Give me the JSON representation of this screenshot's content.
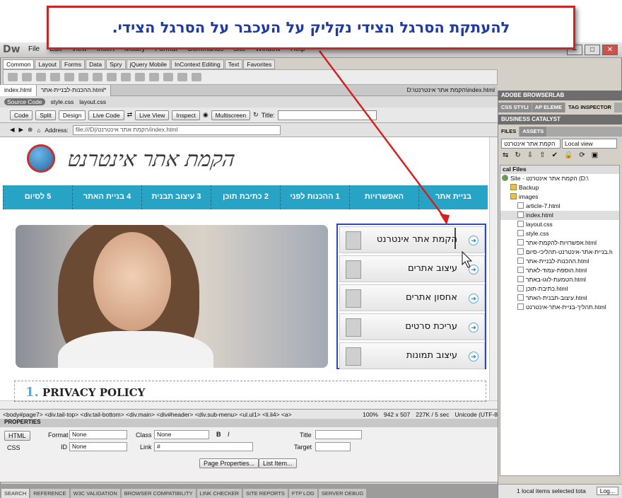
{
  "callout": {
    "text": "להעתקת הסרגל הצידי נקליק על העכבר על הסרגל הצידי."
  },
  "app": {
    "logo": "Dw",
    "menus": [
      "File",
      "Edit",
      "View",
      "Insert",
      "Modify",
      "Format",
      "Commands",
      "Site",
      "Window",
      "Help"
    ]
  },
  "insert_tabs": [
    "Common",
    "Layout",
    "Forms",
    "Data",
    "Spry",
    "jQuery Mobile",
    "InContext Editing",
    "Text",
    "Favorites"
  ],
  "doc_tabs": [
    {
      "label": "index.html"
    },
    {
      "label": "ההכנות-לבניית-אתר.html*"
    }
  ],
  "doc_path": "D:\\הקמת אתר אינטרנט\\index.html",
  "source_bar": {
    "source_code": "Source Code",
    "files": [
      "style.css",
      "layout.css"
    ]
  },
  "view_bar": {
    "code": "Code",
    "split": "Split",
    "design": "Design",
    "live_code": "Live Code",
    "live_view": "Live View",
    "inspect": "Inspect",
    "multiscreen": "Multiscreen",
    "title_label": "Title:"
  },
  "address": {
    "label": "Address:",
    "value": "file:///D|/הקמת אתר אינטרנט/index.html"
  },
  "site": {
    "logo_text": "הקמת אתר אינטרנט",
    "nav": [
      "בניית אתר",
      "האפשרויות",
      "1 ההכנות לפני",
      "2 כתיבת תוכן",
      "3 עיצוב תבנית",
      "4 בניית האתר",
      "5 לסיום"
    ],
    "submenu": [
      "הקמת אתר אינטרנט",
      "עיצוב אתרים",
      "אחסון אתרים",
      "עריכת סרטים",
      "עיצוב תמונות"
    ],
    "privacy_num": "1.",
    "privacy": "PRIVACY POLICY"
  },
  "status": {
    "tags": "<body#page7> <div.tail-top> <div.tail-bottom> <div.main> <div#header> <div.sub-menu> <ul.ul1> <li.li4> <a>",
    "zoom": "100%",
    "dims": "942 x 507",
    "size": "227K / 5 sec",
    "encoding": "Unicode (UTF-8"
  },
  "properties": {
    "header": "PROPERTIES",
    "html": "HTML",
    "css": "CSS",
    "format_label": "Format",
    "format_val": "None",
    "class_label": "Class",
    "class_val": "None",
    "id_label": "ID",
    "id_val": "None",
    "link_label": "Link",
    "link_val": "#",
    "title_label": "Title",
    "target_label": "Target",
    "page_props": "Page Properties...",
    "list_item": "List Item..."
  },
  "bottom_tabs": [
    "SEARCH",
    "REFERENCE",
    "W3C VALIDATION",
    "BROWSER COMPATIBILITY",
    "LINK CHECKER",
    "SITE REPORTS",
    "FTP LOG",
    "SERVER DEBUG"
  ],
  "right_panel": {
    "browserlab": "ADOBE BROWSERLAB",
    "css_tabs": [
      "CSS STYLI",
      "AP ELEME",
      "TAG INSPECTOR"
    ],
    "catalyst": "BUSINESS CATALYST",
    "file_tabs": [
      "FILES",
      "ASSETS"
    ],
    "site_select": "הקמת אתר אינטרנט",
    "view_select": "Local view",
    "tree_header": "cal Files",
    "tree": [
      {
        "label": "Site - הקמת אתר אינטרנט (D:\\",
        "type": "site"
      },
      {
        "label": "Backup",
        "type": "folder"
      },
      {
        "label": "images",
        "type": "folder"
      },
      {
        "label": "article-7.html",
        "type": "file"
      },
      {
        "label": "index.html",
        "type": "file"
      },
      {
        "label": "layout.css",
        "type": "file"
      },
      {
        "label": "style.css",
        "type": "file"
      },
      {
        "label": "אפשרויות-להקמת-אתר.html",
        "type": "file"
      },
      {
        "label": "בניית-אתר-אינטרנט-תהליכי-סיום.h",
        "type": "file"
      },
      {
        "label": "ההכנות-לבניית-אתר.html",
        "type": "file"
      },
      {
        "label": "הוספת-עמוד-לאתר.html",
        "type": "file"
      },
      {
        "label": "הטמעת-לוגו-באתר.html",
        "type": "file"
      },
      {
        "label": "כתיבת-תוכן.html",
        "type": "file"
      },
      {
        "label": "עיצוב-תבנית-האתר.html",
        "type": "file"
      },
      {
        "label": "תהליך-בניית-אתר-אינטרנט.html",
        "type": "file"
      }
    ],
    "status": "1 local items selected tota",
    "log": "Log..."
  }
}
